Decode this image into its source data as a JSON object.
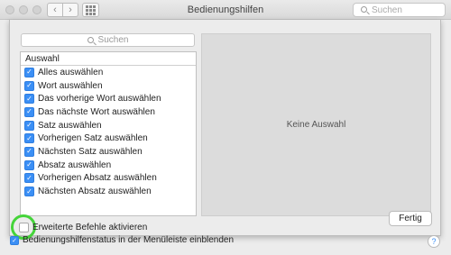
{
  "window": {
    "title": "Bedienungshilfen",
    "search_placeholder": "Suchen",
    "nav_back": "‹",
    "nav_forward": "›"
  },
  "sheet": {
    "search_placeholder": "Suchen",
    "list_header": "Auswahl",
    "items": [
      {
        "label": "Alles auswählen",
        "checked": true
      },
      {
        "label": "Wort auswählen",
        "checked": true
      },
      {
        "label": "Das vorherige Wort auswählen",
        "checked": true
      },
      {
        "label": "Das nächste Wort auswählen",
        "checked": true
      },
      {
        "label": "Satz auswählen",
        "checked": true
      },
      {
        "label": "Vorherigen Satz auswählen",
        "checked": true
      },
      {
        "label": "Nächsten Satz auswählen",
        "checked": true
      },
      {
        "label": "Absatz auswählen",
        "checked": true
      },
      {
        "label": "Vorherigen Absatz auswählen",
        "checked": true
      },
      {
        "label": "Nächsten Absatz auswählen",
        "checked": true
      }
    ],
    "detail_placeholder": "Keine Auswahl",
    "extended_commands_label": "Erweiterte Befehle aktivieren",
    "extended_commands_checked": false,
    "done_button": "Fertig"
  },
  "bottom": {
    "menubar_status_label": "Bedienungshilfenstatus in der Menüleiste einblenden",
    "menubar_status_checked": true,
    "help": "?"
  },
  "colors": {
    "checkbox_accent": "#3b8ff5",
    "focus_highlight": "#45d43a"
  }
}
